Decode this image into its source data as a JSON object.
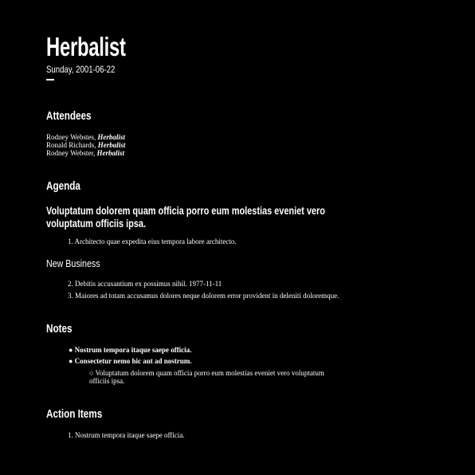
{
  "doc": {
    "title": "Herbalist",
    "date": "Sunday, 2001-06-22"
  },
  "attendees": {
    "heading": "Attendees",
    "list": [
      {
        "name": "Rodney Webstes, ",
        "role": "Herbalist"
      },
      {
        "name": "Ronald Richards, ",
        "role": "Herbalist"
      },
      {
        "name": "Rodney Webster, ",
        "role": "Herbalist"
      }
    ]
  },
  "agenda": {
    "heading": "Agenda",
    "subheading": "Voluptatum dolorem quam officia porro eum molestias eveniet vero voluptatum officiis ipsa.",
    "items": [
      "1. Architecto quae expedita eius tempora labore architecto."
    ]
  },
  "new_business": {
    "heading": "New Business",
    "items": [
      "2. Debitis accusantium ex possimus nihil. 1977-11-11",
      "3. Maiores ad totam accusamus dolores neque dolorem error provident in deleniti doloremque."
    ]
  },
  "notes": {
    "heading": "Notes",
    "items": [
      "● Nostrum tempora itaque saepe officia.",
      "● Consectetur nemo hic aut ad nostrum."
    ],
    "sub_items": [
      "○ Voluptatum dolorem quam officia porro eum molestias eveniet vero voluptatum officiis ipsa."
    ]
  },
  "action_items": {
    "heading": "Action Items",
    "items": [
      "1. Nostrum tempora itaque saepe officia."
    ]
  }
}
